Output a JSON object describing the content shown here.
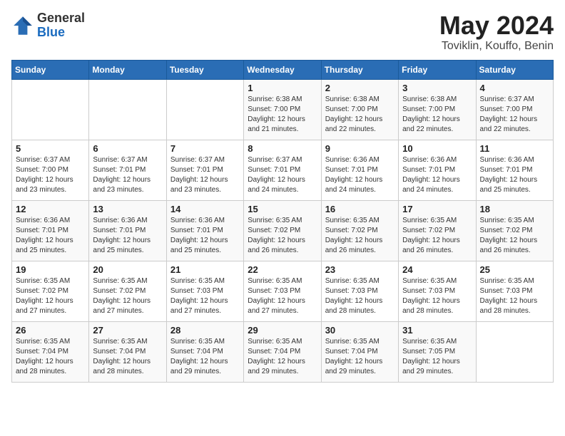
{
  "logo": {
    "general": "General",
    "blue": "Blue"
  },
  "title": {
    "month_year": "May 2024",
    "location": "Toviklin, Kouffo, Benin"
  },
  "days_of_week": [
    "Sunday",
    "Monday",
    "Tuesday",
    "Wednesday",
    "Thursday",
    "Friday",
    "Saturday"
  ],
  "weeks": [
    [
      {
        "day": "",
        "info": ""
      },
      {
        "day": "",
        "info": ""
      },
      {
        "day": "",
        "info": ""
      },
      {
        "day": "1",
        "info": "Sunrise: 6:38 AM\nSunset: 7:00 PM\nDaylight: 12 hours\nand 21 minutes."
      },
      {
        "day": "2",
        "info": "Sunrise: 6:38 AM\nSunset: 7:00 PM\nDaylight: 12 hours\nand 22 minutes."
      },
      {
        "day": "3",
        "info": "Sunrise: 6:38 AM\nSunset: 7:00 PM\nDaylight: 12 hours\nand 22 minutes."
      },
      {
        "day": "4",
        "info": "Sunrise: 6:37 AM\nSunset: 7:00 PM\nDaylight: 12 hours\nand 22 minutes."
      }
    ],
    [
      {
        "day": "5",
        "info": "Sunrise: 6:37 AM\nSunset: 7:00 PM\nDaylight: 12 hours\nand 23 minutes."
      },
      {
        "day": "6",
        "info": "Sunrise: 6:37 AM\nSunset: 7:01 PM\nDaylight: 12 hours\nand 23 minutes."
      },
      {
        "day": "7",
        "info": "Sunrise: 6:37 AM\nSunset: 7:01 PM\nDaylight: 12 hours\nand 23 minutes."
      },
      {
        "day": "8",
        "info": "Sunrise: 6:37 AM\nSunset: 7:01 PM\nDaylight: 12 hours\nand 24 minutes."
      },
      {
        "day": "9",
        "info": "Sunrise: 6:36 AM\nSunset: 7:01 PM\nDaylight: 12 hours\nand 24 minutes."
      },
      {
        "day": "10",
        "info": "Sunrise: 6:36 AM\nSunset: 7:01 PM\nDaylight: 12 hours\nand 24 minutes."
      },
      {
        "day": "11",
        "info": "Sunrise: 6:36 AM\nSunset: 7:01 PM\nDaylight: 12 hours\nand 25 minutes."
      }
    ],
    [
      {
        "day": "12",
        "info": "Sunrise: 6:36 AM\nSunset: 7:01 PM\nDaylight: 12 hours\nand 25 minutes."
      },
      {
        "day": "13",
        "info": "Sunrise: 6:36 AM\nSunset: 7:01 PM\nDaylight: 12 hours\nand 25 minutes."
      },
      {
        "day": "14",
        "info": "Sunrise: 6:36 AM\nSunset: 7:01 PM\nDaylight: 12 hours\nand 25 minutes."
      },
      {
        "day": "15",
        "info": "Sunrise: 6:35 AM\nSunset: 7:02 PM\nDaylight: 12 hours\nand 26 minutes."
      },
      {
        "day": "16",
        "info": "Sunrise: 6:35 AM\nSunset: 7:02 PM\nDaylight: 12 hours\nand 26 minutes."
      },
      {
        "day": "17",
        "info": "Sunrise: 6:35 AM\nSunset: 7:02 PM\nDaylight: 12 hours\nand 26 minutes."
      },
      {
        "day": "18",
        "info": "Sunrise: 6:35 AM\nSunset: 7:02 PM\nDaylight: 12 hours\nand 26 minutes."
      }
    ],
    [
      {
        "day": "19",
        "info": "Sunrise: 6:35 AM\nSunset: 7:02 PM\nDaylight: 12 hours\nand 27 minutes."
      },
      {
        "day": "20",
        "info": "Sunrise: 6:35 AM\nSunset: 7:02 PM\nDaylight: 12 hours\nand 27 minutes."
      },
      {
        "day": "21",
        "info": "Sunrise: 6:35 AM\nSunset: 7:03 PM\nDaylight: 12 hours\nand 27 minutes."
      },
      {
        "day": "22",
        "info": "Sunrise: 6:35 AM\nSunset: 7:03 PM\nDaylight: 12 hours\nand 27 minutes."
      },
      {
        "day": "23",
        "info": "Sunrise: 6:35 AM\nSunset: 7:03 PM\nDaylight: 12 hours\nand 28 minutes."
      },
      {
        "day": "24",
        "info": "Sunrise: 6:35 AM\nSunset: 7:03 PM\nDaylight: 12 hours\nand 28 minutes."
      },
      {
        "day": "25",
        "info": "Sunrise: 6:35 AM\nSunset: 7:03 PM\nDaylight: 12 hours\nand 28 minutes."
      }
    ],
    [
      {
        "day": "26",
        "info": "Sunrise: 6:35 AM\nSunset: 7:04 PM\nDaylight: 12 hours\nand 28 minutes."
      },
      {
        "day": "27",
        "info": "Sunrise: 6:35 AM\nSunset: 7:04 PM\nDaylight: 12 hours\nand 28 minutes."
      },
      {
        "day": "28",
        "info": "Sunrise: 6:35 AM\nSunset: 7:04 PM\nDaylight: 12 hours\nand 29 minutes."
      },
      {
        "day": "29",
        "info": "Sunrise: 6:35 AM\nSunset: 7:04 PM\nDaylight: 12 hours\nand 29 minutes."
      },
      {
        "day": "30",
        "info": "Sunrise: 6:35 AM\nSunset: 7:04 PM\nDaylight: 12 hours\nand 29 minutes."
      },
      {
        "day": "31",
        "info": "Sunrise: 6:35 AM\nSunset: 7:05 PM\nDaylight: 12 hours\nand 29 minutes."
      },
      {
        "day": "",
        "info": ""
      }
    ]
  ]
}
